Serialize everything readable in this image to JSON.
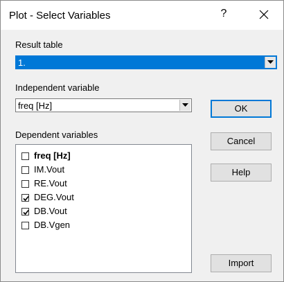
{
  "window": {
    "title": "Plot - Select Variables",
    "help_symbol": "?"
  },
  "result_table": {
    "label": "Result table",
    "value": "1."
  },
  "independent": {
    "label": "Independent variable",
    "value": "freq [Hz]"
  },
  "dependent": {
    "label": "Dependent variables",
    "items": [
      {
        "label": "freq [Hz]",
        "checked": false,
        "bold": true
      },
      {
        "label": "IM.Vout",
        "checked": false,
        "bold": false
      },
      {
        "label": "RE.Vout",
        "checked": false,
        "bold": false
      },
      {
        "label": "DEG.Vout",
        "checked": true,
        "bold": false
      },
      {
        "label": "DB.Vout",
        "checked": true,
        "bold": false
      },
      {
        "label": "DB.Vgen",
        "checked": false,
        "bold": false
      }
    ]
  },
  "buttons": {
    "ok": "OK",
    "cancel": "Cancel",
    "help": "Help",
    "import": "Import"
  },
  "colors": {
    "selection": "#0078d7",
    "dialog_bg": "#f0f0f0"
  }
}
